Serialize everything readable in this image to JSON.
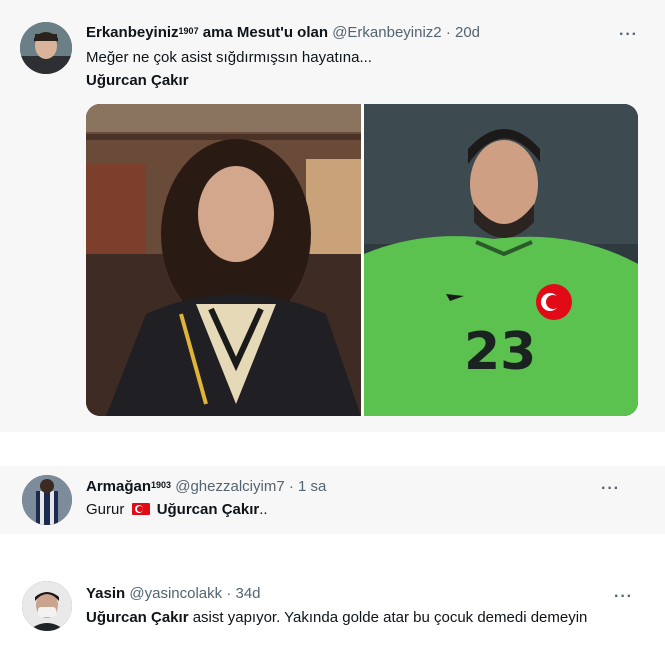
{
  "tweets": [
    {
      "display_name": "Erkanbeyiniz",
      "name_sup": "1907",
      "name_suffix": " ama Mesut'u olan",
      "handle": "@Erkanbeyiniz2",
      "separator": "·",
      "time": "20d",
      "more": "···",
      "text_line1": "Meğer ne çok asist sığdırmışsın hayatına...",
      "text_line2": "Uğurcan Çakır"
    },
    {
      "display_name": "Armağan",
      "name_sup": "1903",
      "handle": "@ghezzalciyim7",
      "separator": "·",
      "time": "1 sa",
      "more": "···",
      "text_prefix": "Gurur",
      "text_bold": "Uğurcan Çakır",
      "text_suffix": ".."
    },
    {
      "display_name": "Yasin",
      "handle": "@yasincolakk",
      "separator": "·",
      "time": "34d",
      "more": "···",
      "text_bold": "Uğurcan Çakır",
      "text_rest": " asist yapıyor. Yakında golde atar bu çocuk demedi demeyin"
    }
  ],
  "media_right": {
    "jersey_number": "23"
  },
  "colors": {
    "tweet_bg": "#f7f7f7",
    "secondary_text": "#536471",
    "jersey_green": "#5cc24f",
    "flag_red": "#e30a17"
  }
}
